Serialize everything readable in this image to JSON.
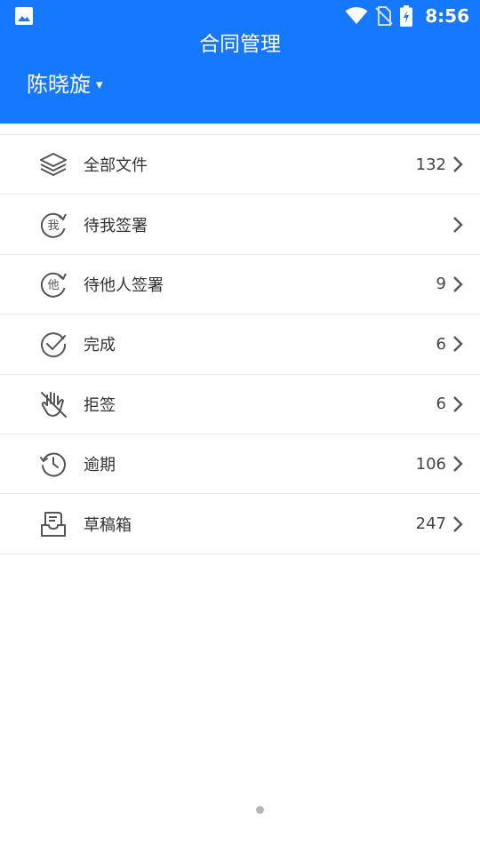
{
  "status_bar": {
    "time": "8:56",
    "icons": [
      "photo-icon",
      "wifi-icon",
      "no-sim-icon",
      "battery-charging-icon"
    ]
  },
  "header": {
    "title": "合同管理",
    "user_name": "陈晓旋",
    "user_caret": "▾",
    "background": "#1677FF"
  },
  "list": {
    "items": [
      {
        "icon": "layers-icon",
        "label": "全部文件",
        "count": "132"
      },
      {
        "icon": "sign-me-icon",
        "label": "待我签署",
        "count": ""
      },
      {
        "icon": "sign-others-icon",
        "label": "待他人签署",
        "count": "9"
      },
      {
        "icon": "check-circle-icon",
        "label": "完成",
        "count": "6"
      },
      {
        "icon": "hand-reject-icon",
        "label": "拒签",
        "count": "6"
      },
      {
        "icon": "history-icon",
        "label": "逾期",
        "count": "106"
      },
      {
        "icon": "inbox-draft-icon",
        "label": "草稿箱",
        "count": "247"
      }
    ]
  }
}
